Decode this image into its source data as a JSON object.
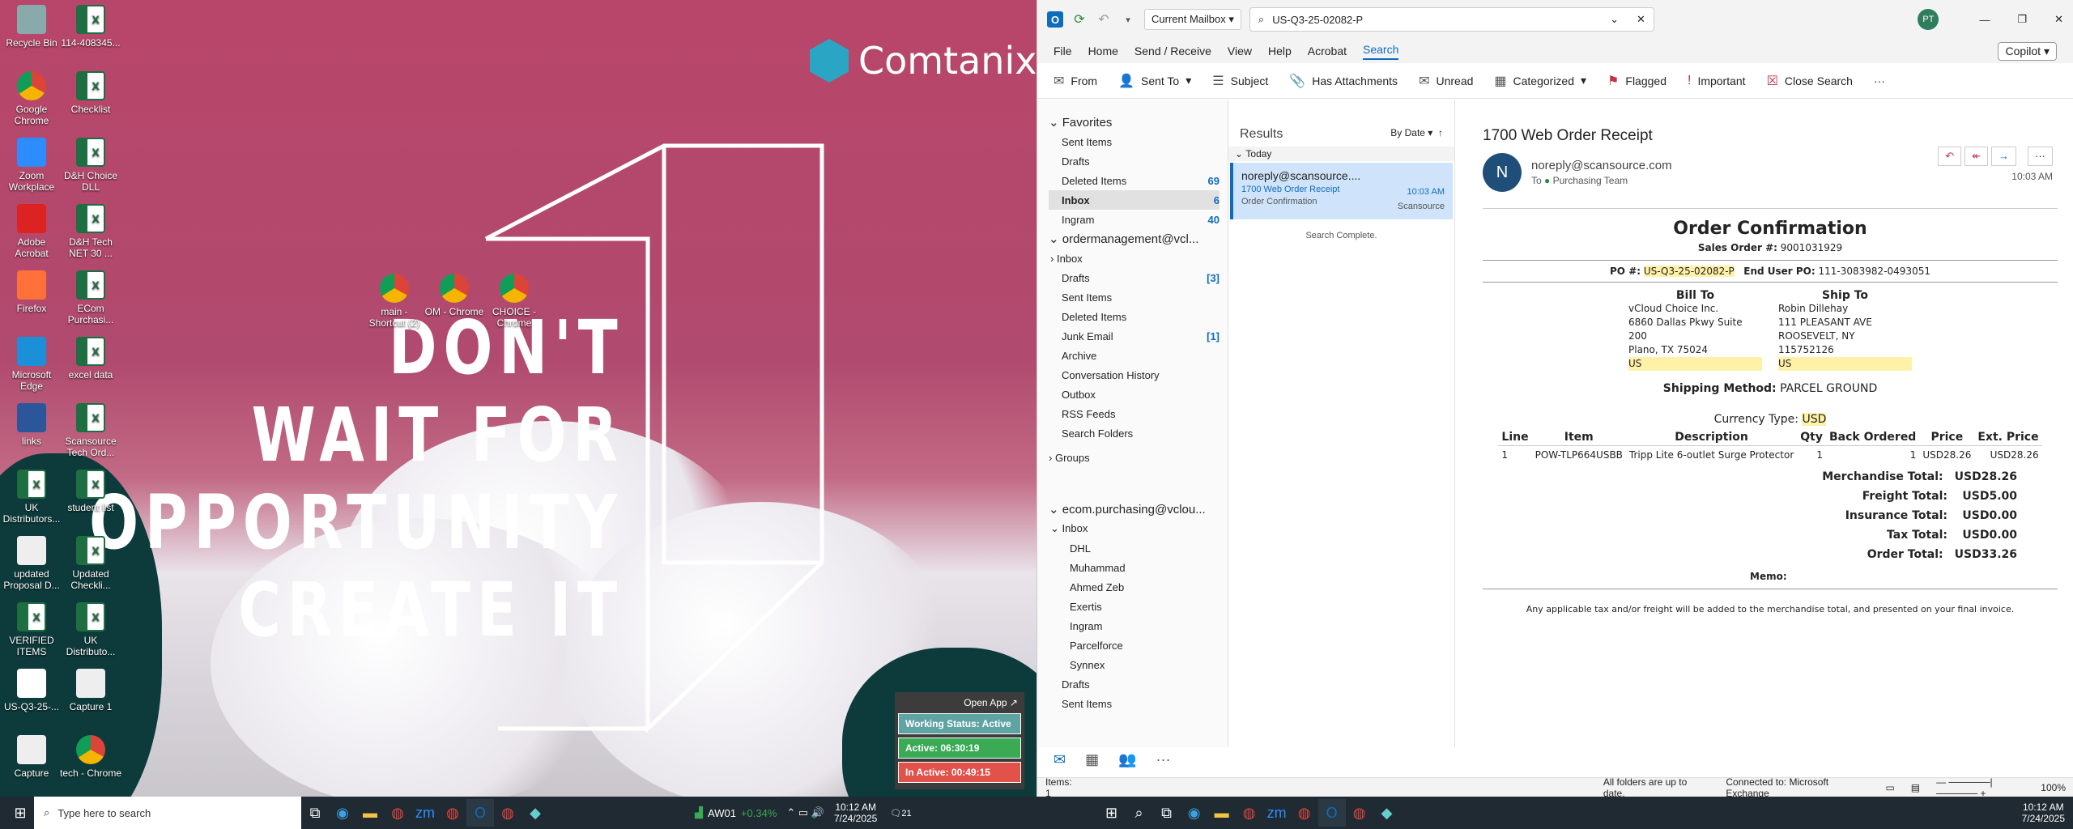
{
  "desktop": {
    "icons": [
      {
        "label": "Recycle Bin",
        "type": "bin"
      },
      {
        "label": "114-408345...",
        "type": "xl"
      },
      {
        "label": "Google Chrome",
        "type": "chrome"
      },
      {
        "label": "Checklist",
        "type": "xl"
      },
      {
        "label": "Zoom Workplace",
        "type": "zoom"
      },
      {
        "label": "D&H Choice DLL",
        "type": "xl"
      },
      {
        "label": "Adobe Acrobat",
        "type": "acrobat"
      },
      {
        "label": "D&H Tech NET 30 ...",
        "type": "xl"
      },
      {
        "label": "Firefox",
        "type": "firefox"
      },
      {
        "label": "ECom Purchasi...",
        "type": "xl"
      },
      {
        "label": "Microsoft Edge",
        "type": "edge"
      },
      {
        "label": "excel data",
        "type": "xl"
      },
      {
        "label": "links",
        "type": "word"
      },
      {
        "label": "Scansource Tech Ord...",
        "type": "xl"
      },
      {
        "label": "UK Distributors...",
        "type": "xl"
      },
      {
        "label": "student list",
        "type": "xl"
      },
      {
        "label": "updated Proposal D...",
        "type": "doc"
      },
      {
        "label": "Updated Checkli...",
        "type": "xl"
      },
      {
        "label": "VERIFIED ITEMS",
        "type": "xl"
      },
      {
        "label": "UK Distributo...",
        "type": "xl"
      },
      {
        "label": "US-Q3-25-...",
        "type": "pdf"
      },
      {
        "label": "Capture 1",
        "type": "img"
      },
      {
        "label": "Capture",
        "type": "doc"
      },
      {
        "label": "tech - Chrome",
        "type": "chrome"
      }
    ],
    "shortcuts": [
      {
        "label": "main - Shortcut (2)"
      },
      {
        "label": "OM - Chrome"
      },
      {
        "label": "CHOICE - Chrome"
      }
    ],
    "brand": "Comtanix",
    "slogan": [
      "DON'T",
      "WAIT FOR",
      "OPPORTUNITY",
      "CREATE IT"
    ],
    "widget": {
      "open_app": "Open App ↗",
      "status": "Working Status: Active",
      "active": "Active: 06:30:19",
      "inactive": "In Active: 00:49:15",
      "colors": {
        "status": "#5fa3a3",
        "active": "#3aaa55",
        "inactive": "#e0524a"
      }
    }
  },
  "outlook": {
    "avatar": "PT",
    "mailbox": "Current Mailbox",
    "search_value": "US-Q3-25-02082-P",
    "tabs": [
      "File",
      "Home",
      "Send / Receive",
      "View",
      "Help",
      "Acrobat",
      "Search"
    ],
    "copilot": "Copilot",
    "toolbar": [
      "From",
      "Sent To",
      "Subject",
      "Has Attachments",
      "Unread",
      "Categorized",
      "Flagged",
      "Important",
      "Close Search"
    ],
    "favorites": {
      "title": "Favorites",
      "items": [
        {
          "name": "Sent Items",
          "count": ""
        },
        {
          "name": "Drafts",
          "count": ""
        },
        {
          "name": "Deleted Items",
          "count": "69"
        },
        {
          "name": "Inbox",
          "count": "6"
        },
        {
          "name": "Ingram",
          "count": "40"
        }
      ]
    },
    "account1": {
      "title": "ordermanagement@vcl...",
      "items": [
        {
          "name": "Inbox",
          "count": ""
        },
        {
          "name": "Drafts",
          "count": "[3]"
        },
        {
          "name": "Sent Items",
          "count": ""
        },
        {
          "name": "Deleted Items",
          "count": ""
        },
        {
          "name": "Junk Email",
          "count": "[1]"
        },
        {
          "name": "Archive",
          "count": ""
        },
        {
          "name": "Conversation History",
          "count": ""
        },
        {
          "name": "Outbox",
          "count": ""
        },
        {
          "name": "RSS Feeds",
          "count": ""
        },
        {
          "name": "Search Folders",
          "count": ""
        }
      ]
    },
    "groups": "Groups",
    "account2": {
      "title": "ecom.purchasing@vclou...",
      "inbox": "Inbox",
      "subs": [
        "DHL",
        "Muhammad",
        "Ahmed Zeb",
        "Exertis",
        "Ingram",
        "Parcelforce",
        "Synnex"
      ],
      "items": [
        "Drafts",
        "Sent Items"
      ]
    },
    "results": {
      "title": "Results",
      "sort": "By Date",
      "group": "Today",
      "complete": "Search Complete.",
      "msg": {
        "from": "noreply@scansource....",
        "subject": "1700 Web Order Receipt",
        "preview": "Order Confirmation",
        "time": "10:03 AM",
        "tag": "Scansource"
      }
    },
    "email": {
      "subject": "1700 Web Order Receipt",
      "avatar": "N",
      "from": "noreply@scansource.com",
      "to_label": "To",
      "to": "Purchasing Team",
      "time": "10:03 AM",
      "title": "Order Confirmation",
      "sales_label": "Sales Order #:",
      "sales": "9001031929",
      "po_label": "PO #:",
      "po": "US-Q3-25-02082-P",
      "eupo_label": "End User PO:",
      "eupo": "111-3083982-0493051",
      "bill_to": "Bill To",
      "ship_to": "Ship To",
      "bill": [
        "vCloud Choice Inc.",
        "6860 Dallas Pkwy Suite 200",
        "Plano, TX 75024",
        "US"
      ],
      "ship": [
        "Robin Dillehay",
        "111 PLEASANT AVE",
        "ROOSEVELT, NY 115752126",
        "US"
      ],
      "ship_method_label": "Shipping Method:",
      "ship_method": "PARCEL GROUND",
      "currency_label": "Currency Type:",
      "currency": "USD",
      "cols": [
        "Line",
        "Item",
        "Description",
        "Qty",
        "Back Ordered",
        "Price",
        "Ext. Price"
      ],
      "row": [
        "1",
        "POW-TLP664USBB",
        "Tripp Lite 6-outlet Surge Protector",
        "1",
        "1",
        "USD28.26",
        "USD28.26"
      ],
      "totals": [
        {
          "label": "Merchandise Total:",
          "value": "USD28.26"
        },
        {
          "label": "Freight Total:",
          "value": "USD5.00"
        },
        {
          "label": "Insurance Total:",
          "value": "USD0.00"
        },
        {
          "label": "Tax Total:",
          "value": "USD0.00"
        },
        {
          "label": "Order Total:",
          "value": "USD33.26"
        }
      ],
      "memo": "Memo:",
      "footer": "Any applicable tax and/or freight will be added to the merchandise total, and presented on your final invoice."
    },
    "status": {
      "items": "Items: 1",
      "sync": "All folders are up to date.",
      "conn": "Connected to: Microsoft Exchange",
      "zoom": "100%"
    }
  },
  "taskbar": {
    "search": "Type here to search",
    "ticker": "AW01",
    "change": "+0.34%",
    "time": "10:12 AM",
    "date": "7/24/2025",
    "notif": "21"
  }
}
